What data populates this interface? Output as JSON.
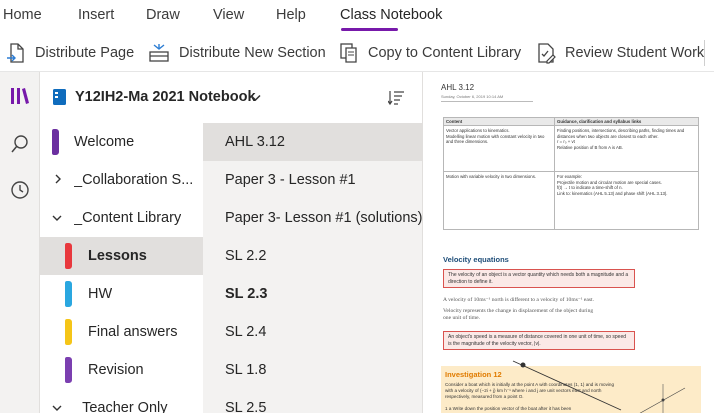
{
  "ribbon_tabs": [
    "Home",
    "Insert",
    "Draw",
    "View",
    "Help",
    "Class Notebook"
  ],
  "active_tab": "Class Notebook",
  "commands": {
    "distribute_page": "Distribute Page",
    "distribute_section": "Distribute New Section",
    "copy_library": "Copy to Content Library",
    "review_work": "Review Student Work"
  },
  "notebook": {
    "title": "Y12IH2-Ma 2021 Notebook"
  },
  "sections": [
    {
      "label": "Welcome",
      "color": "#6b2fa0"
    },
    {
      "label": "_Collaboration S..."
    },
    {
      "label": "_Content Library"
    },
    {
      "label": "Lessons",
      "color": "#e8383d"
    },
    {
      "label": "HW",
      "color": "#2aa7e0"
    },
    {
      "label": "Final answers",
      "color": "#f5c518"
    },
    {
      "label": "Revision",
      "color": "#7b3fb0"
    },
    {
      "label": "_Teacher Only"
    }
  ],
  "pages": [
    "AHL 3.12",
    "Paper 3 - Lesson #1",
    "Paper 3- Lesson #1 (solutions)",
    "SL 2.2",
    "SL 2.3",
    "SL 2.4",
    "SL 1.8",
    "SL 2.5"
  ],
  "page_content": {
    "title": "AHL 3.12",
    "date": "Sunday, October 6, 2019     10:14 AM",
    "table": {
      "col1": "Content",
      "col2": "Guidance, clarification and syllabus links",
      "r1c1": "Vector applications to kinematics.\nModelling linear motion with constant velocity in two and three dimensions.",
      "r1c2": "Finding positions, intersections, describing paths, finding times and distances when two objects are closest to each other.\nr = r₀ + vt\nRelative position of B from A is AB.",
      "r2c1": "Motion with variable velocity in two dimensions.",
      "r2c2": "For example:\nProjectile motion and circular motion are special cases.\nf(t) → t to indicate a time-shift of n.\nLink to: kinematics (AHL 5.13) and phase shift (AHL 3.13)."
    },
    "heading": "Velocity equations",
    "def1": "The velocity of an object is a vector quantity which needs both a magnitude and a direction to define it.",
    "para1": "A velocity of 10ms⁻¹ north is different to a velocity of 10ms⁻¹ east.",
    "para2": "Velocity represents the change in displacement of the object during\none unit of time.",
    "def2": "An object's speed is a measure of distance covered in one unit of time, so speed is the magnitude of the velocity vector, |v|.",
    "investigation_title": "Investigation 12",
    "investigation_text": "Consider a boat which is initially at the point A with coordinates (1, 1) and is moving with a velocity of (−2i + j) km h⁻¹ where i and j are unit vectors east and north respectively, measured from a point O.",
    "investigation_q": "1  a   Write down the position vector of the boat after it has been"
  }
}
